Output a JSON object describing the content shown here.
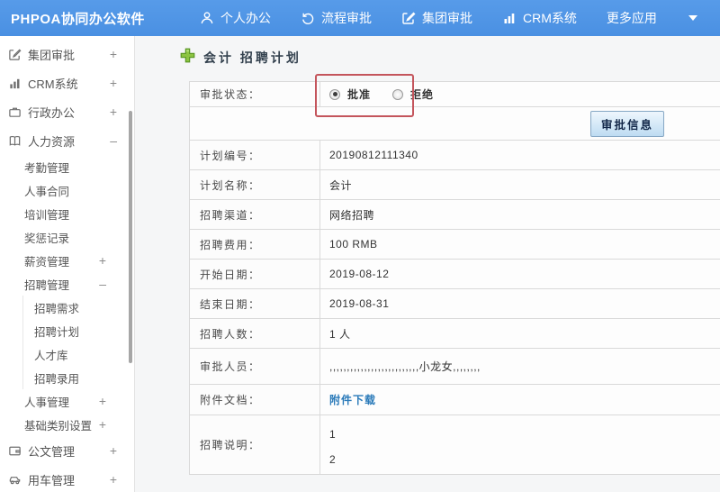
{
  "navbar": {
    "brand": "PHPOA协同办公软件",
    "items": [
      {
        "label": "个人办公",
        "icon": "user-icon"
      },
      {
        "label": "流程审批",
        "icon": "history-icon"
      },
      {
        "label": "集团审批",
        "icon": "edit-icon"
      },
      {
        "label": "CRM系统",
        "icon": "bar-chart-icon"
      },
      {
        "label": "更多应用",
        "icon": "caret-down-icon"
      }
    ]
  },
  "sidebar": {
    "items": [
      {
        "label": "集团审批",
        "icon": "edit-icon",
        "expand": "+"
      },
      {
        "label": "CRM系统",
        "icon": "bar-chart-icon",
        "expand": "+"
      },
      {
        "label": "行政办公",
        "icon": "briefcase-icon",
        "expand": "+"
      },
      {
        "label": "人力资源",
        "icon": "book-icon",
        "expand": "–"
      },
      {
        "label": "考勤管理"
      },
      {
        "label": "人事合同"
      },
      {
        "label": "培训管理"
      },
      {
        "label": "奖惩记录"
      },
      {
        "label": "薪资管理",
        "expand": "+"
      },
      {
        "label": "招聘管理",
        "expand": "–"
      },
      {
        "label": "招聘需求"
      },
      {
        "label": "招聘计划"
      },
      {
        "label": "人才库"
      },
      {
        "label": "招聘录用"
      },
      {
        "label": "人事管理",
        "expand": "+"
      },
      {
        "label": "基础类别设置",
        "expand": "+"
      },
      {
        "label": "公文管理",
        "icon": "document-icon",
        "expand": "+"
      },
      {
        "label": "用车管理",
        "icon": "car-icon",
        "expand": "+"
      }
    ]
  },
  "main": {
    "page_title": "会计 招聘计划",
    "form": {
      "status_label": "审批状态：",
      "status_options": [
        {
          "label": "批准",
          "checked": true
        },
        {
          "label": "拒绝",
          "checked": false
        }
      ],
      "approve_button": "审批信息",
      "rows": [
        {
          "label": "计划编号：",
          "value": "20190812111340"
        },
        {
          "label": "计划名称：",
          "value": "会计"
        },
        {
          "label": "招聘渠道：",
          "value": "网络招聘"
        },
        {
          "label": "招聘费用：",
          "value": "100 RMB"
        },
        {
          "label": "开始日期：",
          "value": "2019-08-12"
        },
        {
          "label": "结束日期：",
          "value": "2019-08-31"
        },
        {
          "label": "招聘人数：",
          "value": "1 人"
        },
        {
          "label": "审批人员：",
          "value": ",,,,,,,,,,,,,,,,,,,,,,,,,,小龙女,,,,,,,,"
        },
        {
          "label": "附件文档：",
          "value": "附件下载"
        }
      ],
      "description_row": {
        "label": "招聘说明：",
        "lines": [
          "1",
          "2"
        ]
      }
    },
    "colors": {
      "navbar_blue": "#4a90e2",
      "annotation_red": "#c4555c",
      "link_blue": "#2a7ab9"
    }
  }
}
